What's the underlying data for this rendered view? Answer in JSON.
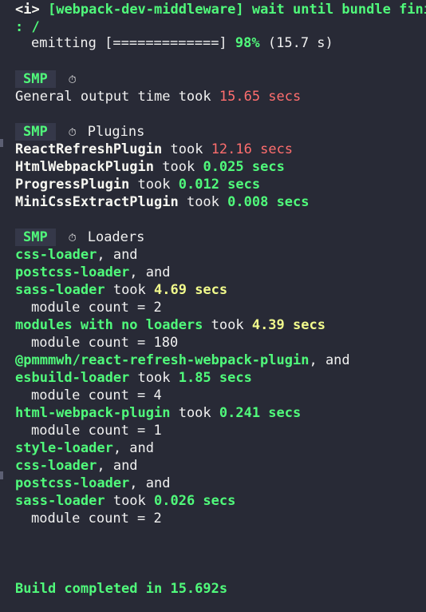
{
  "header": {
    "wdm_prefix": "<i>",
    "wdm_message": "[webpack-dev-middleware] wait until bundle finis",
    "colon_path": ": /",
    "emitting_label": "emitting",
    "progress_bar": "[=============]",
    "progress_pct": "98%",
    "progress_time": "(15.7 s)"
  },
  "smp_badge": "SMP",
  "icons": {
    "stopwatch": "stopwatch-icon"
  },
  "general": {
    "label": "General output time took",
    "time": "15.65 secs"
  },
  "plugins": {
    "heading": "Plugins",
    "items": [
      {
        "name": "ReactRefreshPlugin",
        "took": "took",
        "time": "12.16 secs"
      },
      {
        "name": "HtmlWebpackPlugin",
        "took": "took",
        "time": "0.025 secs"
      },
      {
        "name": "ProgressPlugin",
        "took": "took",
        "time": "0.012 secs"
      },
      {
        "name": "MiniCssExtractPlugin",
        "took": "took",
        "time": "0.008 secs"
      }
    ]
  },
  "loaders": {
    "heading": "Loaders",
    "lines": [
      {
        "a": "css-loader",
        "b": ", and"
      },
      {
        "a": "postcss-loader",
        "b": ", and"
      },
      {
        "a": "sass-loader",
        "b": " took ",
        "c": "4.69 secs"
      },
      {
        "a": "module count = 2"
      },
      {
        "a": "modules with no loaders",
        "b": " took ",
        "c": "4.39 secs"
      },
      {
        "a": "module count = 180"
      },
      {
        "a": "@pmmmwh/react-refresh-webpack-plugin",
        "b": ", and"
      },
      {
        "a": "esbuild-loader",
        "b": " took ",
        "c": "1.85 secs"
      },
      {
        "a": "module count = 4"
      },
      {
        "a": "html-webpack-plugin",
        "b": " took ",
        "c": "0.241 secs"
      },
      {
        "a": "module count = 1"
      },
      {
        "a": "style-loader",
        "b": ", and"
      },
      {
        "a": "css-loader",
        "b": ", and"
      },
      {
        "a": "postcss-loader",
        "b": ", and"
      },
      {
        "a": "sass-loader",
        "b": " took ",
        "c": "0.026 secs"
      },
      {
        "a": "module count = 2"
      }
    ]
  },
  "footer": {
    "build_complete": "Build completed in 15.692s"
  },
  "colors": {
    "background": "#282a36",
    "green": "#50fa7b",
    "red": "#ff6e6e",
    "yellow": "#f1fa8c"
  }
}
